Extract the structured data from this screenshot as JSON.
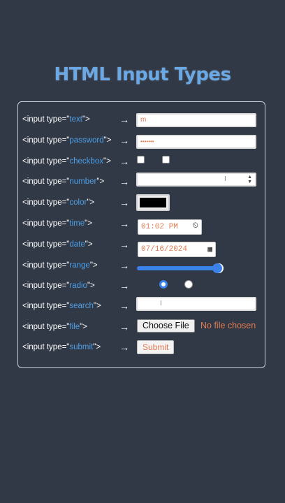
{
  "title": "HTML Input Types",
  "arrow": "→",
  "rows": [
    {
      "prefix": "<input type=\"",
      "type": "text",
      "suffix": "\">"
    },
    {
      "prefix": "<input type=\"",
      "type": "password",
      "suffix": "\">"
    },
    {
      "prefix": "<input type=\"",
      "type": "checkbox",
      "suffix": "\">"
    },
    {
      "prefix": "<input type=\"",
      "type": "number",
      "suffix": "\">"
    },
    {
      "prefix": "<input type=\"",
      "type": "color",
      "suffix": "\">"
    },
    {
      "prefix": "<input type=\"",
      "type": "time",
      "suffix": "\">"
    },
    {
      "prefix": "<input type=\"",
      "type": "date",
      "suffix": "\">"
    },
    {
      "prefix": "<input type=\"",
      "type": "range",
      "suffix": "\">"
    },
    {
      "prefix": "<input type=\"",
      "type": "radio",
      "suffix": "\">"
    },
    {
      "prefix": "<input type=\"",
      "type": "search",
      "suffix": "\">"
    },
    {
      "prefix": "<input type=\"",
      "type": "file",
      "suffix": "\">"
    },
    {
      "prefix": "<input type=\"",
      "type": "submit",
      "suffix": "\">"
    }
  ],
  "inputs": {
    "text_value": "m",
    "password_value": "•••••••",
    "color_value": "#000000",
    "time_value": "01:02 PM",
    "date_value": "07/16/2024",
    "range_value_fraction": 0.95,
    "file_button": "Choose File",
    "file_status": "No file chosen",
    "submit_label": "Submit"
  },
  "colors": {
    "background": "#323946",
    "title": "#6aa9e6",
    "keyword": "#4c9fe6",
    "value_text": "#e07a52",
    "accent": "#3b82e8"
  },
  "icons": {
    "time": "clock-icon",
    "date": "calendar-icon",
    "number": "spinner-arrows-icon"
  }
}
